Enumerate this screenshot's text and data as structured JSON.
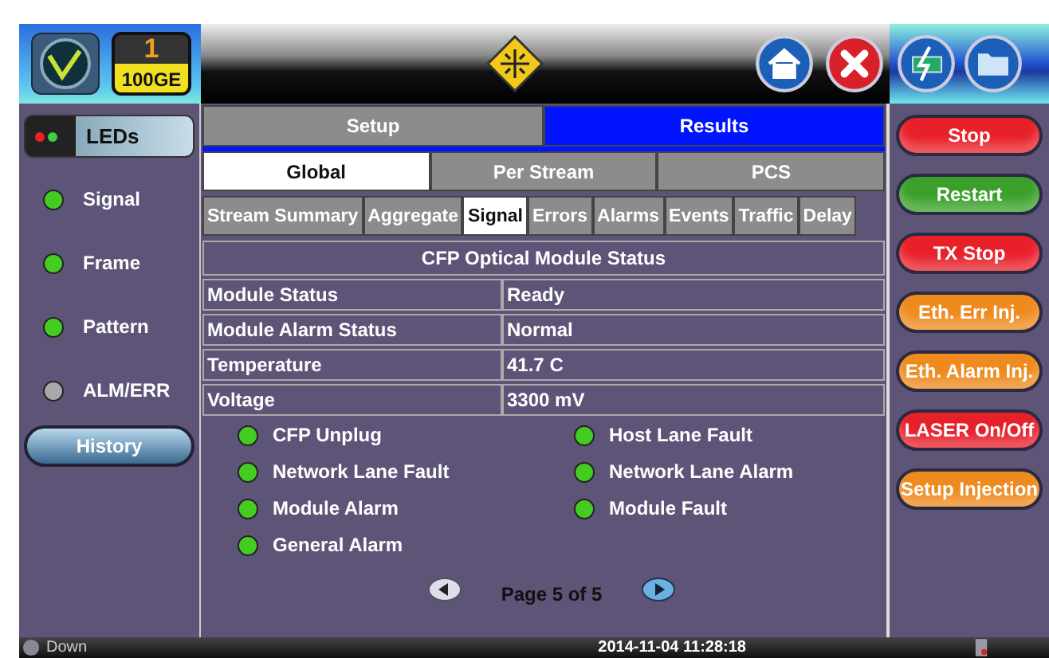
{
  "header": {
    "port": "1",
    "rate": "100GE"
  },
  "sidebar": {
    "leds_button": "LEDs",
    "leds": [
      {
        "label": "Signal",
        "color": "#44cc22"
      },
      {
        "label": "Frame",
        "color": "#44cc22"
      },
      {
        "label": "Pattern",
        "color": "#44cc22"
      },
      {
        "label": "ALM/ERR",
        "color": "#a8a8a8"
      }
    ],
    "history_button": "History"
  },
  "main_tabs": [
    {
      "label": "Setup",
      "selected": false
    },
    {
      "label": "Results",
      "selected": true
    }
  ],
  "sub_tabs": [
    {
      "label": "Global",
      "selected": true
    },
    {
      "label": "Per Stream",
      "selected": false
    },
    {
      "label": "PCS",
      "selected": false
    }
  ],
  "result_tabs": [
    {
      "label": "Stream Summary",
      "selected": false
    },
    {
      "label": "Aggregate",
      "selected": false
    },
    {
      "label": "Signal",
      "selected": true
    },
    {
      "label": "Errors",
      "selected": false
    },
    {
      "label": "Alarms",
      "selected": false
    },
    {
      "label": "Events",
      "selected": false
    },
    {
      "label": "Traffic",
      "selected": false
    },
    {
      "label": "Delay",
      "selected": false
    }
  ],
  "table": {
    "title": "CFP Optical Module Status",
    "rows": [
      {
        "label": "Module Status",
        "value": "Ready"
      },
      {
        "label": "Module Alarm Status",
        "value": "Normal"
      },
      {
        "label": "Temperature",
        "value": "41.7 C"
      },
      {
        "label": "Voltage",
        "value": "3300 mV"
      }
    ]
  },
  "alarms": [
    {
      "label": "CFP Unplug",
      "color": "#44cc22"
    },
    {
      "label": "Host Lane Fault",
      "color": "#44cc22"
    },
    {
      "label": "Network Lane Fault",
      "color": "#44cc22"
    },
    {
      "label": "Network Lane Alarm",
      "color": "#44cc22"
    },
    {
      "label": "Module Alarm",
      "color": "#44cc22"
    },
    {
      "label": "Module Fault",
      "color": "#44cc22"
    },
    {
      "label": "General Alarm",
      "color": "#44cc22"
    }
  ],
  "pager": "Page 5 of 5",
  "actions": [
    {
      "label": "Stop",
      "color": "#e8202a"
    },
    {
      "label": "Restart",
      "color": "#3aa02a"
    },
    {
      "label": "TX Stop",
      "color": "#e8202a"
    },
    {
      "label": "Eth. Err Inj.",
      "color": "#ee8a1e"
    },
    {
      "label": "Eth. Alarm Inj.",
      "color": "#ee8a1e"
    },
    {
      "label": "LASER On/Off",
      "color": "#e8202a"
    },
    {
      "label": "Setup Injection",
      "color": "#ee8a1e"
    }
  ],
  "status_bar": {
    "link": "Down",
    "datetime": "2014-11-04  11:28:18"
  }
}
